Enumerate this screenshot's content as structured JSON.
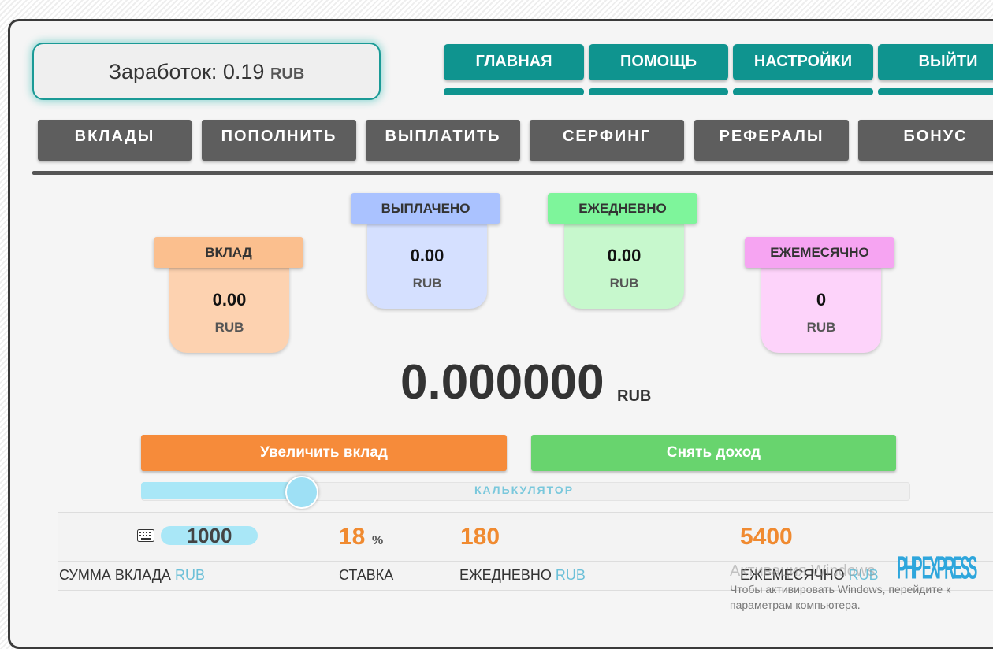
{
  "earnings": {
    "label": "Заработок:",
    "value": "0.19",
    "currency": "RUB"
  },
  "top_nav": [
    "ГЛАВНАЯ",
    "ПОМОЩЬ",
    "НАСТРОЙКИ",
    "ВЫЙТИ"
  ],
  "tabs": [
    "ВКЛАДЫ",
    "ПОПОЛНИТЬ",
    "ВЫПЛАТИТЬ",
    "СЕРФИНГ",
    "РЕФЕРАЛЫ",
    "БОНУС"
  ],
  "stats": [
    {
      "title": "ВКЛАД",
      "value": "0.00",
      "currency": "RUB",
      "tab_color": "#fbbf8e",
      "body_color": "#fdd2b0"
    },
    {
      "title": "ВЫПЛАЧЕНО",
      "value": "0.00",
      "currency": "RUB",
      "tab_color": "#aac2ff",
      "body_color": "#d5e0ff"
    },
    {
      "title": "ЕЖЕДНЕВНО",
      "value": "0.00",
      "currency": "RUB",
      "tab_color": "#7ef59b",
      "body_color": "#c7f8cd"
    },
    {
      "title": "ЕЖЕМЕСЯЧНО",
      "value": "0",
      "currency": "RUB",
      "tab_color": "#f6a4f2",
      "body_color": "#fdd3fa"
    }
  ],
  "total": {
    "value": "0.000000",
    "currency": "RUB"
  },
  "buttons": {
    "increase": "Увеличить вклад",
    "withdraw": "Снять доход"
  },
  "calculator": {
    "label": "КАЛЬКУЛЯТОР",
    "slider_fraction": 0.21,
    "amount": "1000",
    "rate": "18",
    "rate_unit": "%",
    "daily": "180",
    "monthly": "5400",
    "labels": {
      "amount": "СУММА ВКЛАДА",
      "rate": "СТАВКА",
      "daily": "ЕЖЕДНЕВНО",
      "monthly": "ЕЖЕМЕСЯЧНО",
      "currency": "RUB"
    }
  },
  "watermark": {
    "title": "Активация Windows",
    "subtitle": "Чтобы активировать Windows, перейдите к параметрам компьютера."
  },
  "logo": {
    "text": "PHP EXPRESS"
  },
  "colors": {
    "teal": "#0f948f",
    "tab_gray": "#5e5e5e",
    "orange": "#f68b3a",
    "green": "#68d46e",
    "cyan": "#a9e7f7"
  }
}
